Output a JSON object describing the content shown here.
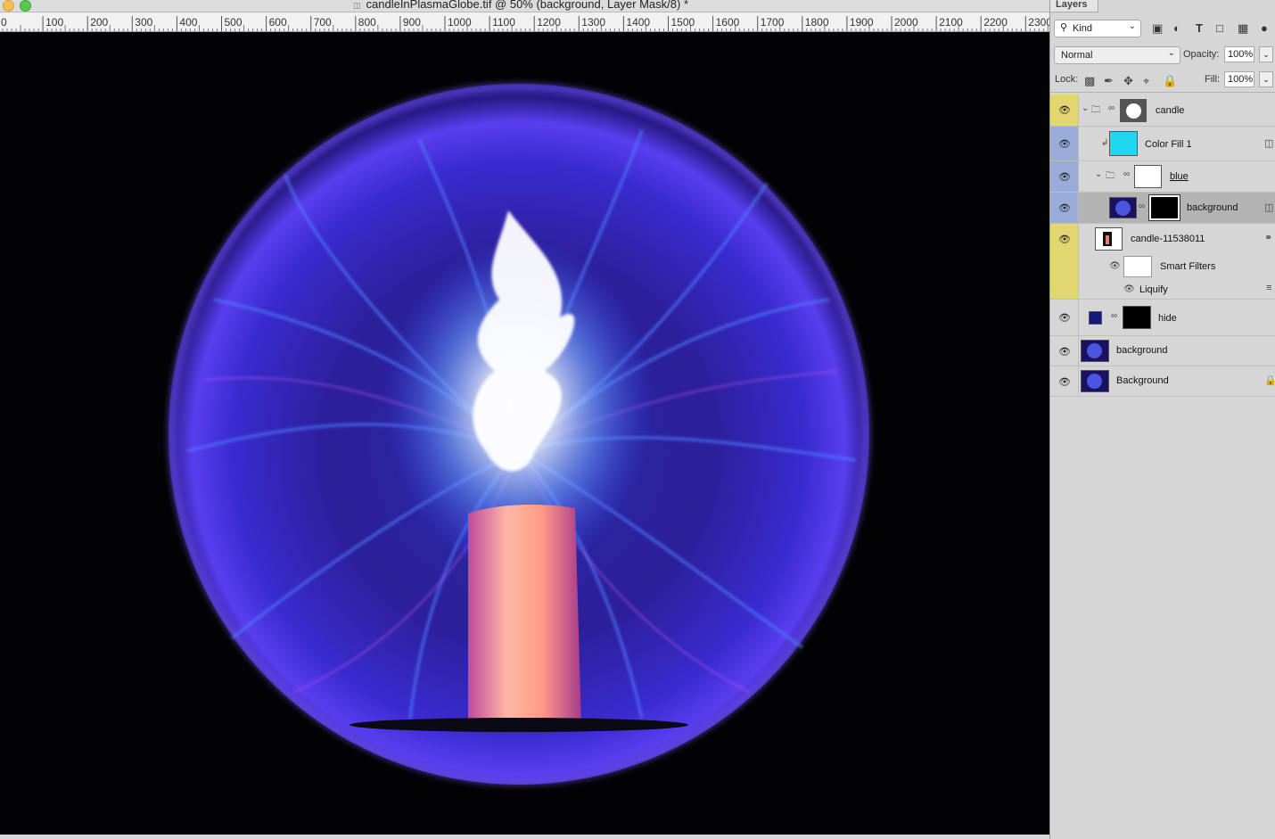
{
  "window": {
    "title": "candleInPlasmaGlobe.tif @ 50% (background, Layer Mask/8) *"
  },
  "ruler": {
    "ticks": [
      "0",
      "100",
      "200",
      "300",
      "400",
      "500",
      "600",
      "700",
      "800",
      "900",
      "1000",
      "1100",
      "1200",
      "1300",
      "1400",
      "1500",
      "1600",
      "1700",
      "1800",
      "1900",
      "2000",
      "2100",
      "2200",
      "2300"
    ]
  },
  "layers_panel": {
    "tab": "Layers",
    "filter": {
      "kind": "Kind"
    },
    "blend_mode": "Normal",
    "opacity_label": "Opacity:",
    "opacity": "100%",
    "lock_label": "Lock:",
    "fill_label": "Fill:",
    "fill": "100%",
    "layers": [
      {
        "name": "candle",
        "type": "group",
        "visible": true,
        "highlight": "yellow"
      },
      {
        "name": "Color Fill 1",
        "type": "fill",
        "visible": true,
        "highlight": "blue",
        "color": "#1fd8f0"
      },
      {
        "name": "blue",
        "type": "group",
        "visible": true,
        "highlight": "blue"
      },
      {
        "name": "background",
        "type": "smart-object-mask",
        "visible": true,
        "highlight": "blue",
        "selected": true
      },
      {
        "name": "candle-11538011",
        "type": "smart-object",
        "visible": true,
        "highlight": "yellow"
      },
      {
        "name": "Smart Filters",
        "type": "smart-filters",
        "visible": true
      },
      {
        "name": "Liquify",
        "type": "filter",
        "visible": true
      },
      {
        "name": "hide",
        "type": "fill-mask",
        "visible": true,
        "color": "#141a7a"
      },
      {
        "name": "background",
        "type": "smart-object",
        "visible": true
      },
      {
        "name": "Background",
        "type": "locked",
        "visible": true
      }
    ]
  },
  "colors": {
    "group_yellow": "#e1d66f",
    "group_blue": "#98acd9",
    "selected_row": "#b3b3b3"
  }
}
